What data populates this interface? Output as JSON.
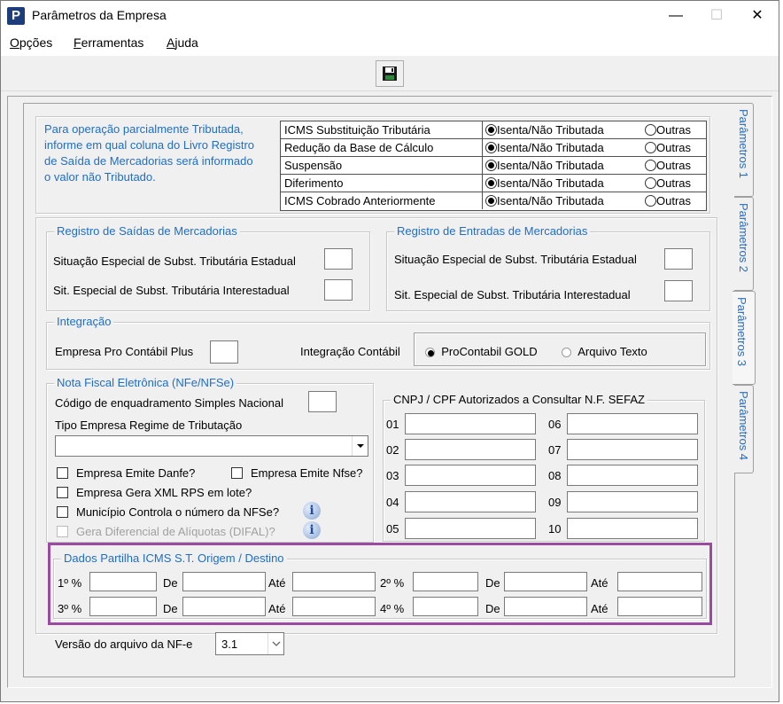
{
  "window": {
    "title": "Parâmetros da Empresa",
    "controls": {
      "minimize": "—",
      "maximize": "☐",
      "close": "✕"
    }
  },
  "menu": {
    "items": [
      {
        "pre": "",
        "u": "O",
        "post": "pções"
      },
      {
        "pre": "",
        "u": "F",
        "post": "erramentas"
      },
      {
        "pre": "",
        "u": "A",
        "post": "juda"
      }
    ]
  },
  "toolbar": {
    "save_icon": "save-disk-icon"
  },
  "tabs": [
    "Parâmetros 1",
    "Parâmetros 2",
    "Parâmetros 3",
    "Parâmetros 4"
  ],
  "info_text": [
    "Para operação parcialmente Tributada,",
    "informe em qual coluna do Livro Registro",
    "de Saída de Mercadorias será informado",
    "o valor não Tributado."
  ],
  "tax_grid": {
    "option_on": "Isenta/Não Tributada",
    "option_off": "Outras",
    "rows": [
      "ICMS Substituição Tributária",
      "Redução da Base de Cálculo",
      "Suspensão",
      "Diferimento",
      "ICMS Cobrado Anteriormente"
    ]
  },
  "saidas": {
    "title": "Registro de Saídas de Mercadorias",
    "estadual": "Situação Especial de Subst. Tributária Estadual",
    "interestadual": "Sit. Especial de Subst. Tributária Interestadual"
  },
  "entradas": {
    "title": "Registro de Entradas de Mercadorias",
    "estadual": "Situação Especial de Subst. Tributária Estadual",
    "interestadual": "Sit. Especial de Subst. Tributária Interestadual"
  },
  "integracao": {
    "title": "Integração",
    "plus_label": "Empresa Pro Contábil Plus",
    "contabil_label": "Integração Contábil",
    "option_gold": "ProContabil GOLD",
    "option_texto": "Arquivo Texto"
  },
  "nfe": {
    "title": "Nota Fiscal Eletrônica (NFe/NFSe)",
    "codigo_label": "Código de enquadramento Simples Nacional",
    "tipo_label": "Tipo Empresa Regime de Tributação",
    "tipo_value": "",
    "danfe": "Empresa Emite Danfe?",
    "nfse": "Empresa Emite Nfse?",
    "xml": "Empresa Gera XML RPS em lote?",
    "municipio": "Município Controla o número da NFSe?",
    "difal": "Gera Diferencial de Alíquotas (DIFAL)?"
  },
  "cnpj": {
    "title": "CNPJ / CPF Autorizados a Consultar N.F. SEFAZ",
    "left": [
      "01",
      "02",
      "03",
      "04",
      "05"
    ],
    "right": [
      "06",
      "07",
      "08",
      "09",
      "10"
    ]
  },
  "partilha": {
    "title": "Dados Partilha ICMS S.T. Origem / Destino",
    "row1": [
      "1º %",
      "De",
      "Até",
      "2º %",
      "De",
      "Até"
    ],
    "row2": [
      "3º %",
      "De",
      "Até",
      "4º %",
      "De",
      "Até"
    ]
  },
  "versao": {
    "label": "Versão do arquivo da NF-e",
    "value": "3.1"
  }
}
